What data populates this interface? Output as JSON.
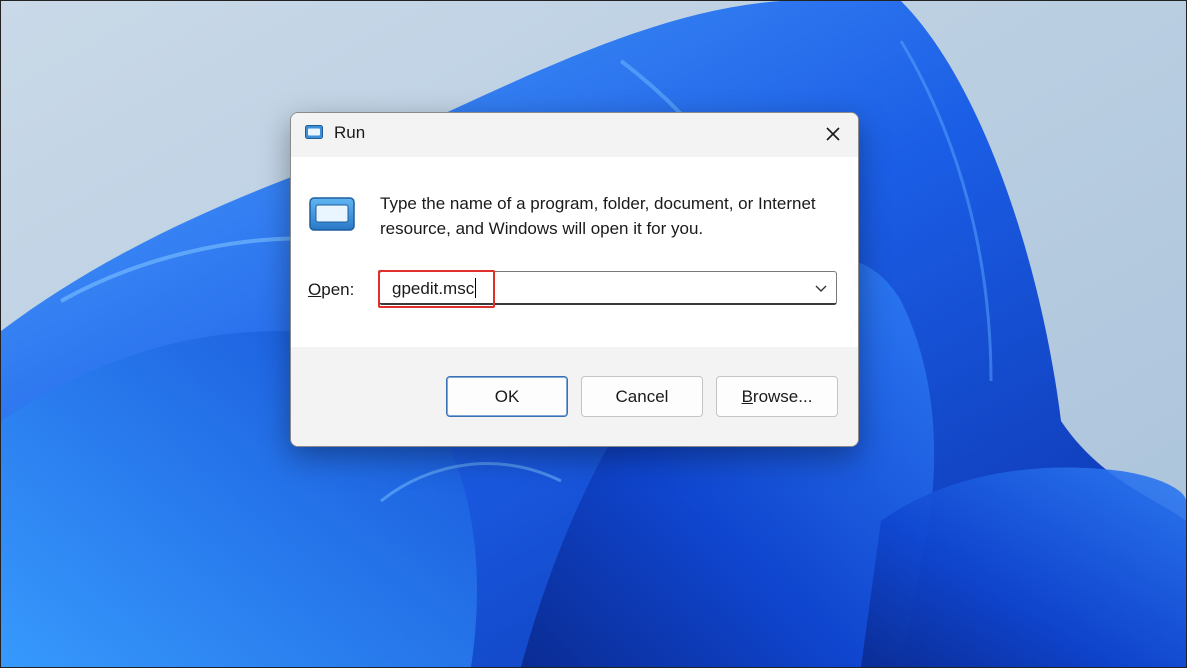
{
  "dialog": {
    "title": "Run",
    "description": "Type the name of a program, folder, document, or Internet resource, and Windows will open it for you.",
    "open_label_access_key": "O",
    "open_label_rest": "pen:",
    "open_value": "gpedit.msc",
    "buttons": {
      "ok": "OK",
      "cancel": "Cancel",
      "browse_access_key": "B",
      "browse_rest": "rowse..."
    }
  },
  "icons": {
    "title": "run-app-icon",
    "content": "run-app-icon",
    "close": "close-icon",
    "dropdown": "chevron-down-icon"
  },
  "colors": {
    "highlight": "#e0302b",
    "accent": "#3b6fb3",
    "wallpaper_blue": "#1f5fe0"
  }
}
